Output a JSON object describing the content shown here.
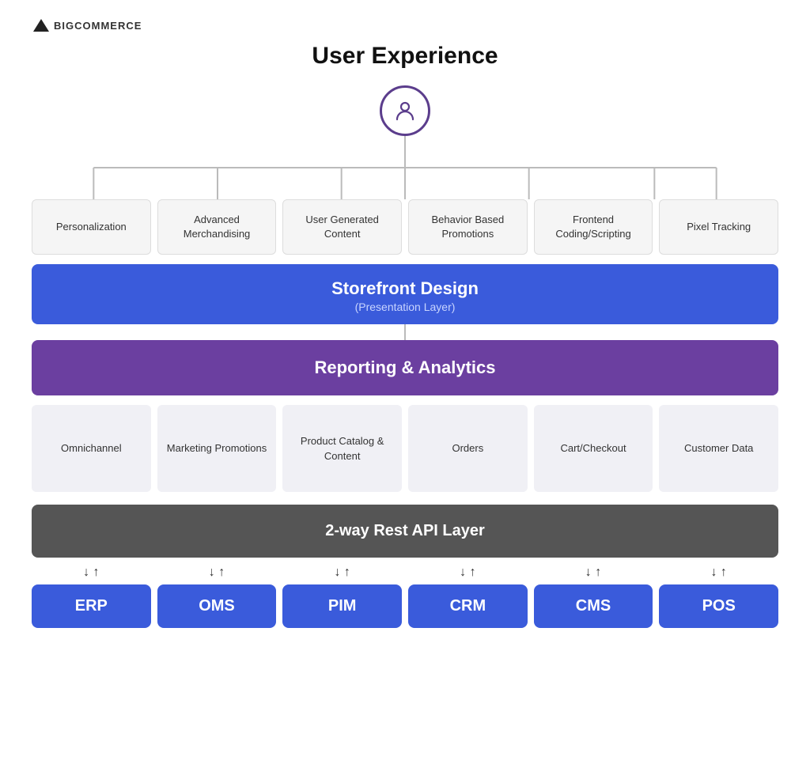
{
  "logo": {
    "text": "BIGCOMMERCE"
  },
  "title": "User Experience",
  "ux_cards": [
    {
      "label": "Personalization"
    },
    {
      "label": "Advanced Merchandising"
    },
    {
      "label": "User Generated Content"
    },
    {
      "label": "Behavior Based Promotions"
    },
    {
      "label": "Frontend Coding/Scripting"
    },
    {
      "label": "Pixel Tracking"
    }
  ],
  "storefront": {
    "title": "Storefront Design",
    "subtitle": "(Presentation Layer)"
  },
  "reporting": {
    "title": "Reporting & Analytics"
  },
  "grid_cards": [
    {
      "label": "Omnichannel"
    },
    {
      "label": "Marketing Promotions"
    },
    {
      "label": "Product Catalog & Content"
    },
    {
      "label": "Orders"
    },
    {
      "label": "Cart/Checkout"
    },
    {
      "label": "Customer Data"
    }
  ],
  "api_layer": {
    "title": "2-way Rest API Layer"
  },
  "systems": [
    {
      "label": "ERP",
      "arrows": "↓ ↑"
    },
    {
      "label": "OMS",
      "arrows": "↓ ↑"
    },
    {
      "label": "PIM",
      "arrows": "↓ ↑"
    },
    {
      "label": "CRM",
      "arrows": "↓ ↑"
    },
    {
      "label": "CMS",
      "arrows": "↓ ↑"
    },
    {
      "label": "POS",
      "arrows": "↓ ↑"
    }
  ]
}
